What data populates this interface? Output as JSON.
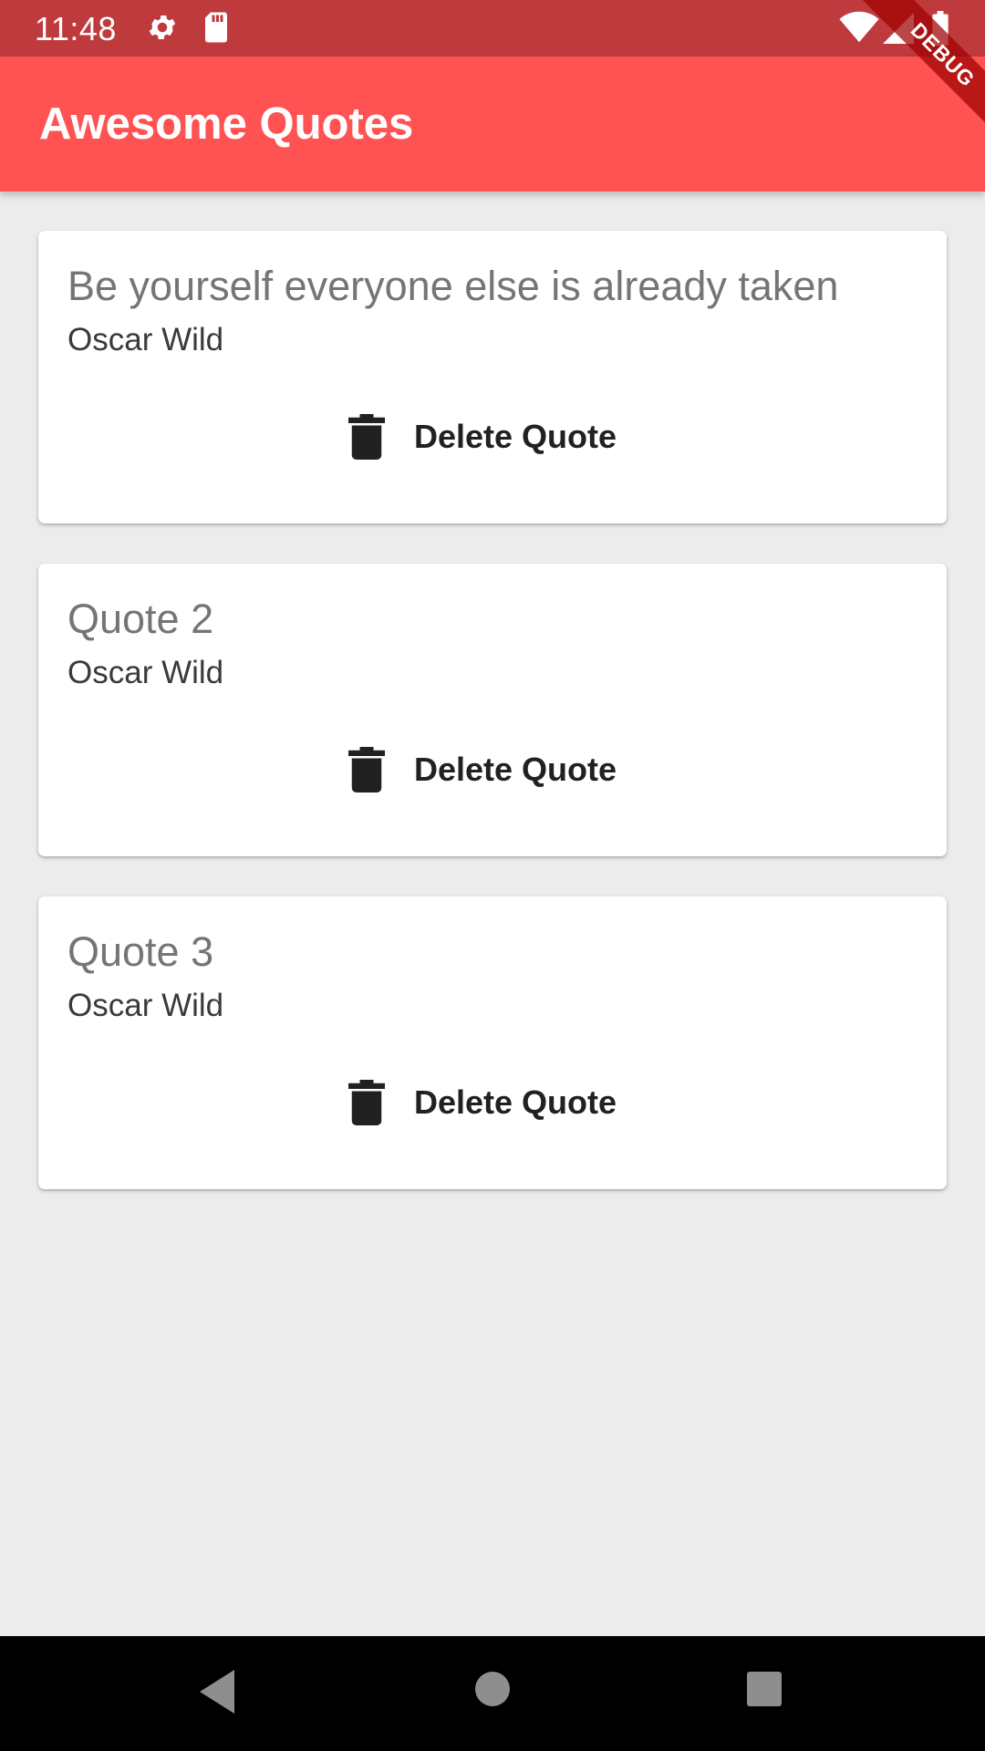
{
  "status_bar": {
    "time": "11:48",
    "icons": [
      "settings-gear-icon",
      "sd-card-icon",
      "wifi-icon",
      "cell-signal-icon",
      "battery-icon"
    ]
  },
  "app_bar": {
    "title": "Awesome Quotes",
    "color": "#ff5252"
  },
  "debug_banner": {
    "label": "DEBUG"
  },
  "quotes": [
    {
      "text": "Be yourself everyone else is already taken",
      "author": "Oscar Wild",
      "delete_label": "Delete Quote",
      "icon": "trash-icon"
    },
    {
      "text": "Quote 2",
      "author": "Oscar Wild",
      "delete_label": "Delete Quote",
      "icon": "trash-icon"
    },
    {
      "text": "Quote 3",
      "author": "Oscar Wild",
      "delete_label": "Delete Quote",
      "icon": "trash-icon"
    }
  ],
  "nav_bar": {
    "buttons": [
      "back-triangle-icon",
      "home-circle-icon",
      "recents-square-icon"
    ]
  },
  "colors": {
    "status_bar": "#bf3a3d",
    "background": "#ececec",
    "card": "#ffffff"
  }
}
